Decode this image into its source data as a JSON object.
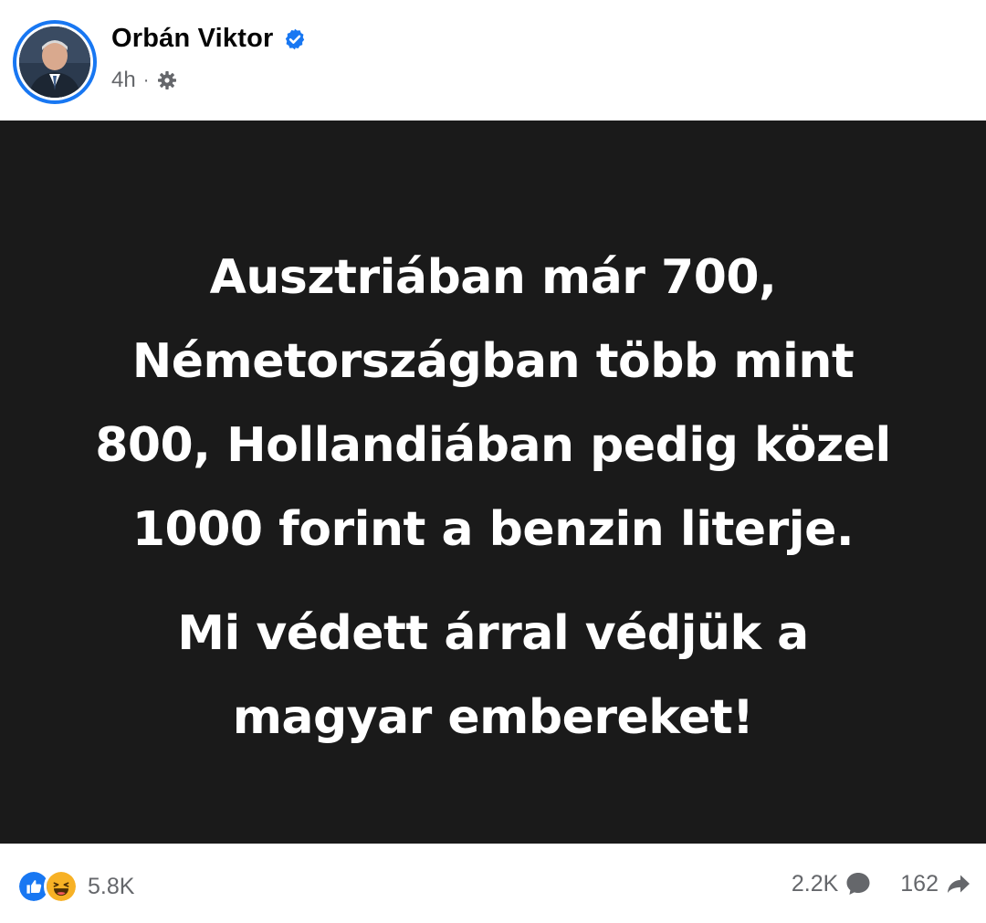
{
  "author": {
    "name": "Orbán Viktor",
    "verified_icon": "verified-badge-icon",
    "time": "4h",
    "separator": "·",
    "privacy_icon": "gear-icon"
  },
  "post_image": {
    "background": "#1a1a1a",
    "text_color": "#ffffff",
    "paragraph1": [
      "Ausztriában már 700,",
      "Németországban több mint",
      "800, Hollandiában pedig közel",
      "1000 forint a benzin literje."
    ],
    "paragraph2": [
      "Mi védett árral védjük a",
      "magyar embereket!"
    ]
  },
  "footer": {
    "reaction_icons": [
      "like-icon",
      "haha-icon"
    ],
    "reaction_count": "5.8K",
    "comments_count": "2.2K",
    "comments_icon": "comment-bubble-icon",
    "shares_count": "162",
    "shares_icon": "share-arrow-icon"
  },
  "colors": {
    "brand_blue": "#1877f2",
    "secondary_text": "#65676b",
    "haha_yellow": "#f7b125"
  }
}
